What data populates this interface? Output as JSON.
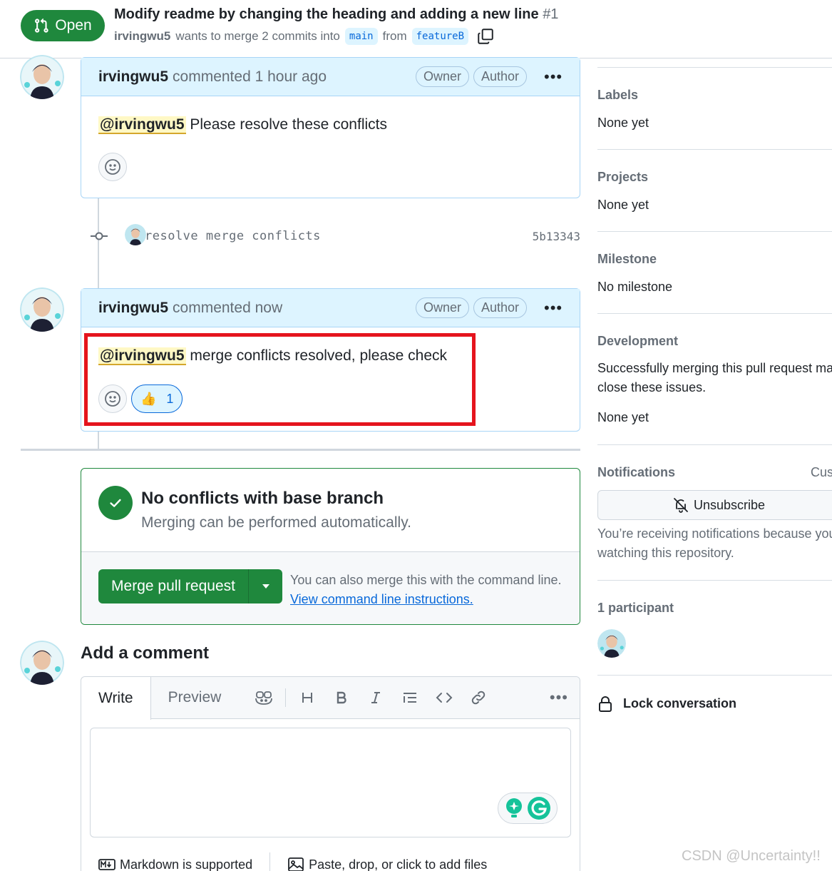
{
  "header": {
    "state": "Open",
    "title": "Modify readme by changing the heading and adding a new line",
    "number": "#1",
    "author": "irvingwu5",
    "meta_text": "wants to merge 2 commits into",
    "base_branch": "main",
    "from_text": "from",
    "head_branch": "featureB"
  },
  "comments": [
    {
      "author": "irvingwu5",
      "time": "commented 1 hour ago",
      "labels": [
        "Owner",
        "Author"
      ],
      "mention": "@irvingwu5",
      "body": "Please resolve these conflicts"
    },
    {
      "author": "irvingwu5",
      "time": "commented now",
      "labels": [
        "Owner",
        "Author"
      ],
      "mention": "@irvingwu5",
      "body": "merge conflicts resolved, please check",
      "reaction_emoji": "👍",
      "reaction_count": "1"
    }
  ],
  "commit": {
    "message": "resolve merge conflicts",
    "sha": "5b13343"
  },
  "merge": {
    "title": "No conflicts with base branch",
    "subtitle": "Merging can be performed automatically.",
    "button": "Merge pull request",
    "hint": "You can also merge this with the command line.",
    "link": "View command line instructions."
  },
  "add_comment": {
    "title": "Add a comment",
    "tab_write": "Write",
    "tab_preview": "Preview",
    "markdown_note": "Markdown is supported",
    "files_note": "Paste, drop, or click to add files"
  },
  "sidebar": {
    "labels_head": "Labels",
    "labels_val": "None yet",
    "projects_head": "Projects",
    "projects_val": "None yet",
    "milestone_head": "Milestone",
    "milestone_val": "No milestone",
    "development_head": "Development",
    "development_line1": "Successfully merging this pull request ma",
    "development_line2": "close these issues.",
    "development_val": "None yet",
    "notifications_head": "Notifications",
    "notifications_customize": "Cus",
    "unsubscribe": "Unsubscribe",
    "notif_line1": "You’re receiving notifications because you",
    "notif_line2": "watching this repository.",
    "participants_head": "1 participant",
    "lock": "Lock conversation"
  },
  "watermark": "CSDN @Uncertainty!!",
  "colors": {
    "green": "#1f883d",
    "blue": "#0969da",
    "highlight_red": "#e5141d",
    "comment_header": "#ddf4ff"
  }
}
